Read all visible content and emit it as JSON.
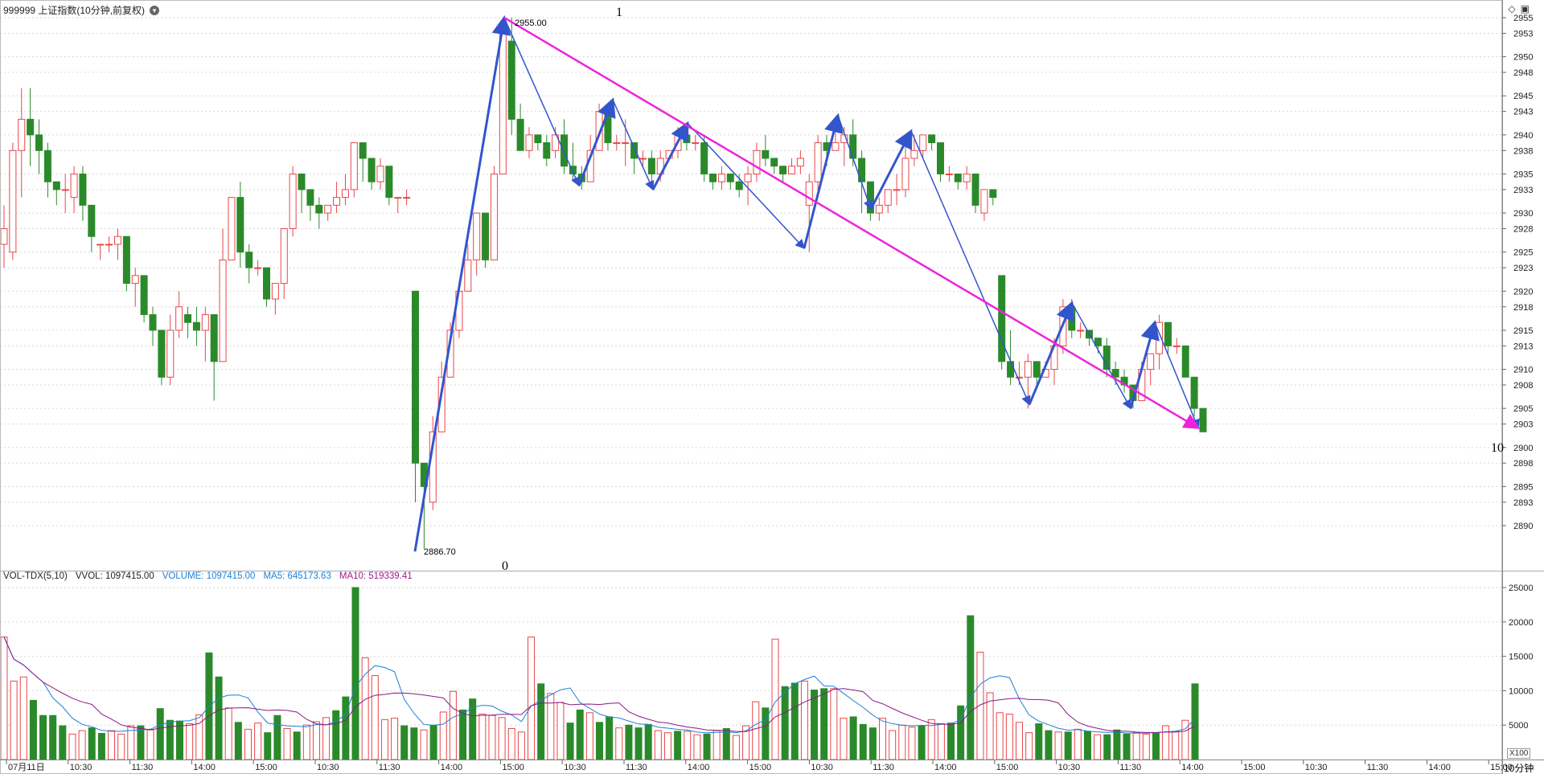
{
  "header": {
    "symbol_title": "999999 上证指数(10分钟,前复权)",
    "dropdown_icon": "chevron-down-icon",
    "icons": [
      "diamond-icon",
      "window-icon"
    ]
  },
  "volume_header": {
    "indicator": "VOL-TDX(5,10)",
    "vvol": "VVOL: 1097415.00",
    "volume": "VOLUME: 1097415.00",
    "ma5": "MA5: 645173.63",
    "ma10": "MA10: 519339.41"
  },
  "footer": {
    "period": "10分钟",
    "vol_scale": "X100"
  },
  "colors": {
    "up": "#e8474a",
    "down": "#2a8a2a",
    "wave": "#3355cc",
    "trend": "#ee22dd",
    "ma5": "#1e7fd6",
    "ma10": "#8b1a85",
    "grid": "#d9d9d9"
  },
  "annotations": {
    "high_label": "2955.00",
    "low_label": "2886.70",
    "wave_start": "0",
    "wave_top": "1",
    "wave_end": "10"
  },
  "chart_data": [
    {
      "type": "candlestick",
      "y_ticks": [
        "2955",
        "2953",
        "2950",
        "2948",
        "2945",
        "2943",
        "2940",
        "2938",
        "2935",
        "2933",
        "2930",
        "2928",
        "2925",
        "2923",
        "2920",
        "2918",
        "2915",
        "2913",
        "2910",
        "2908",
        "2905",
        "2903",
        "2900",
        "2898",
        "2895",
        "2893",
        "2890"
      ],
      "ylim": [
        2887,
        2955
      ],
      "x_ticks": [
        "07月11日",
        "10:30",
        "11:30",
        "14:00",
        "15:00",
        "10:30",
        "11:30",
        "14:00",
        "15:00",
        "10:30",
        "11:30",
        "14:00",
        "15:00",
        "10:30",
        "11:30",
        "14:00",
        "15:00",
        "10:30",
        "11:30",
        "14:00",
        "15:00",
        "10:30",
        "11:30",
        "14:00",
        "15:00"
      ],
      "candles": [
        [
          2926,
          2928,
          2931,
          2923
        ],
        [
          2925,
          2938,
          2939,
          2924
        ],
        [
          2938,
          2942,
          2946,
          2932
        ],
        [
          2942,
          2940,
          2946,
          2936
        ],
        [
          2940,
          2938,
          2942,
          2935
        ],
        [
          2938,
          2934,
          2939,
          2932
        ],
        [
          2934,
          2933,
          2934,
          2931
        ],
        [
          2933,
          2933,
          2935,
          2930
        ],
        [
          2932,
          2935,
          2936,
          2930
        ],
        [
          2935,
          2931,
          2936,
          2929
        ],
        [
          2931,
          2927,
          2931,
          2925
        ],
        [
          2926,
          2926,
          2926,
          2924
        ],
        [
          2926,
          2926,
          2927,
          2925
        ],
        [
          2926,
          2927,
          2928,
          2924
        ],
        [
          2927,
          2921,
          2927,
          2920
        ],
        [
          2921,
          2922,
          2923,
          2918
        ],
        [
          2922,
          2917,
          2922,
          2916
        ],
        [
          2917,
          2915,
          2918,
          2913
        ],
        [
          2915,
          2909,
          2915,
          2908
        ],
        [
          2909,
          2915,
          2917,
          2908
        ],
        [
          2915,
          2918,
          2920,
          2914
        ],
        [
          2917,
          2916,
          2918,
          2914
        ],
        [
          2916,
          2915,
          2918,
          2913
        ],
        [
          2915,
          2917,
          2918,
          2911
        ],
        [
          2917,
          2911,
          2917,
          2906
        ],
        [
          2911,
          2924,
          2928,
          2911
        ],
        [
          2924,
          2932,
          2932,
          2924
        ],
        [
          2932,
          2925,
          2934,
          2923
        ],
        [
          2925,
          2923,
          2926,
          2921
        ],
        [
          2923,
          2923,
          2924,
          2922
        ],
        [
          2923,
          2919,
          2923,
          2918
        ],
        [
          2919,
          2921,
          2921,
          2917
        ],
        [
          2921,
          2928,
          2928,
          2919
        ],
        [
          2928,
          2935,
          2936,
          2927
        ],
        [
          2935,
          2933,
          2935,
          2930
        ],
        [
          2933,
          2931,
          2933,
          2929
        ],
        [
          2931,
          2930,
          2932,
          2928
        ],
        [
          2930,
          2931,
          2931,
          2929
        ],
        [
          2931,
          2932,
          2934,
          2930
        ],
        [
          2932,
          2933,
          2935,
          2931
        ],
        [
          2933,
          2939,
          2939,
          2932
        ],
        [
          2939,
          2937,
          2939,
          2934
        ],
        [
          2937,
          2934,
          2936,
          2933
        ],
        [
          2934,
          2936,
          2937,
          2933
        ],
        [
          2936,
          2932,
          2936,
          2931
        ],
        [
          2932,
          2932,
          2932,
          2930
        ],
        [
          2932,
          2932,
          2933,
          2931
        ],
        [
          2920,
          2898,
          2920,
          2893
        ],
        [
          2898,
          2895,
          2898,
          2887
        ],
        [
          2893,
          2902,
          2904,
          2892
        ],
        [
          2902,
          2909,
          2911,
          2902
        ],
        [
          2909,
          2915,
          2916,
          2909
        ],
        [
          2915,
          2920,
          2921,
          2914
        ],
        [
          2920,
          2924,
          2926,
          2920
        ],
        [
          2924,
          2930,
          2930,
          2922
        ],
        [
          2930,
          2924,
          2930,
          2923
        ],
        [
          2924,
          2935,
          2936,
          2924
        ],
        [
          2935,
          2953,
          2953,
          2935
        ],
        [
          2952,
          2942,
          2955,
          2940
        ],
        [
          2942,
          2938,
          2944,
          2938
        ],
        [
          2938,
          2940,
          2941,
          2937
        ],
        [
          2940,
          2939,
          2940,
          2938
        ],
        [
          2939,
          2937,
          2940,
          2936
        ],
        [
          2938,
          2940,
          2941,
          2937
        ],
        [
          2940,
          2936,
          2942,
          2935
        ],
        [
          2936,
          2935,
          2939,
          2934
        ],
        [
          2935,
          2934,
          2936,
          2933
        ],
        [
          2934,
          2938,
          2940,
          2934
        ],
        [
          2938,
          2943,
          2944,
          2938
        ],
        [
          2943,
          2939,
          2944,
          2938
        ],
        [
          2939,
          2939,
          2940,
          2938
        ],
        [
          2939,
          2939,
          2942,
          2936
        ],
        [
          2939,
          2937,
          2939,
          2935
        ],
        [
          2937,
          2937,
          2938,
          2936
        ],
        [
          2937,
          2935,
          2938,
          2934
        ],
        [
          2935,
          2937,
          2938,
          2934
        ],
        [
          2937,
          2938,
          2938,
          2937
        ],
        [
          2938,
          2940,
          2941,
          2937
        ],
        [
          2940,
          2939,
          2940,
          2938
        ],
        [
          2939,
          2939,
          2940,
          2938
        ],
        [
          2939,
          2935,
          2940,
          2934
        ],
        [
          2935,
          2934,
          2935,
          2933
        ],
        [
          2934,
          2935,
          2936,
          2933
        ],
        [
          2935,
          2934,
          2935,
          2933
        ],
        [
          2934,
          2933,
          2935,
          2932
        ],
        [
          2934,
          2935,
          2936,
          2931
        ],
        [
          2935,
          2938,
          2939,
          2934
        ],
        [
          2938,
          2937,
          2940,
          2936
        ],
        [
          2937,
          2936,
          2937,
          2935
        ],
        [
          2936,
          2935,
          2936,
          2934
        ],
        [
          2935,
          2936,
          2937,
          2935
        ],
        [
          2936,
          2937,
          2938,
          2935
        ],
        [
          2931,
          2934,
          2935,
          2925
        ],
        [
          2934,
          2939,
          2940,
          2933
        ],
        [
          2939,
          2938,
          2940,
          2936
        ],
        [
          2938,
          2939,
          2942,
          2938
        ],
        [
          2939,
          2940,
          2941,
          2936
        ],
        [
          2940,
          2937,
          2942,
          2936
        ],
        [
          2937,
          2934,
          2938,
          2930
        ],
        [
          2934,
          2930,
          2934,
          2929
        ],
        [
          2930,
          2931,
          2932,
          2929
        ],
        [
          2931,
          2933,
          2933,
          2930
        ],
        [
          2933,
          2933,
          2935,
          2931
        ],
        [
          2933,
          2937,
          2939,
          2932
        ],
        [
          2937,
          2938,
          2940,
          2936
        ],
        [
          2938,
          2940,
          2940,
          2937
        ],
        [
          2940,
          2939,
          2940,
          2938
        ],
        [
          2939,
          2935,
          2939,
          2934
        ],
        [
          2935,
          2935,
          2936,
          2934
        ],
        [
          2935,
          2934,
          2935,
          2933
        ],
        [
          2934,
          2935,
          2936,
          2933
        ],
        [
          2935,
          2931,
          2935,
          2930
        ],
        [
          2930,
          2933,
          2933,
          2929
        ],
        [
          2933,
          2932,
          2933,
          2931
        ],
        [
          2922,
          2911,
          2922,
          2910
        ],
        [
          2911,
          2909,
          2915,
          2908
        ],
        [
          2909,
          2909,
          2911,
          2908
        ],
        [
          2909,
          2911,
          2912,
          2905
        ],
        [
          2911,
          2909,
          2911,
          2908
        ],
        [
          2909,
          2910,
          2911,
          2909
        ],
        [
          2910,
          2913,
          2914,
          2908
        ],
        [
          2913,
          2918,
          2919,
          2912
        ],
        [
          2918,
          2915,
          2919,
          2914
        ],
        [
          2915,
          2915,
          2916,
          2914
        ],
        [
          2915,
          2914,
          2915,
          2913
        ],
        [
          2914,
          2913,
          2914,
          2912
        ],
        [
          2913,
          2910,
          2914,
          2909
        ],
        [
          2910,
          2909,
          2911,
          2908
        ],
        [
          2909,
          2908,
          2910,
          2907
        ],
        [
          2908,
          2906,
          2908,
          2905
        ],
        [
          2906,
          2910,
          2911,
          2906
        ],
        [
          2910,
          2912,
          2912,
          2908
        ],
        [
          2912,
          2916,
          2917,
          2910
        ],
        [
          2916,
          2913,
          2916,
          2912
        ],
        [
          2913,
          2913,
          2914,
          2912
        ],
        [
          2913,
          2909,
          2913,
          2909
        ],
        [
          2909,
          2905,
          2909,
          2904
        ],
        [
          2905,
          2902,
          2905,
          2902
        ]
      ],
      "wave_points": [
        [
          516,
          2886.7
        ],
        [
          627,
          2955.0
        ],
        [
          720,
          2933.5
        ],
        [
          762,
          2944.5
        ],
        [
          812,
          2933.0
        ],
        [
          855,
          2941.5
        ],
        [
          1000,
          2925.5
        ],
        [
          1042,
          2942.5
        ],
        [
          1083,
          2930.5
        ],
        [
          1133,
          2940.5
        ],
        [
          1280,
          2905.5
        ],
        [
          1333,
          2918.5
        ],
        [
          1406,
          2905.0
        ],
        [
          1436,
          2916.0
        ],
        [
          1490,
          2902.5
        ]
      ],
      "trend_line": [
        [
          627,
          2955.0
        ],
        [
          1490,
          2902.5
        ]
      ]
    },
    {
      "type": "bar",
      "title": "VOL-TDX(5,10)",
      "y_ticks": [
        "25000",
        "20000",
        "15000",
        "10000",
        "5000"
      ],
      "ylim": [
        0,
        25000
      ],
      "volumes": [
        17800,
        11400,
        12000,
        8600,
        6400,
        6400,
        4900,
        3700,
        4200,
        4600,
        3800,
        4200,
        3700,
        4900,
        4900,
        4300,
        7400,
        5700,
        5600,
        5200,
        6500,
        15500,
        12000,
        7500,
        5400,
        4400,
        5300,
        3900,
        6400,
        4500,
        4000,
        5000,
        5500,
        6100,
        7100,
        9100,
        25000,
        14800,
        12200,
        5800,
        6000,
        4900,
        4600,
        4300,
        5000,
        6900,
        9900,
        7200,
        8800,
        6600,
        6400,
        6100,
        4500,
        4000,
        17800,
        11000,
        9600,
        8300,
        5300,
        7200,
        6800,
        5400,
        6200,
        4600,
        5000,
        4600,
        5100,
        4200,
        3900,
        4100,
        4100,
        3600,
        3700,
        4200,
        4500,
        3500,
        4900,
        8400,
        7500,
        17500,
        10600,
        11100,
        11400,
        10100,
        10300,
        10300,
        6000,
        6200,
        5100,
        4600,
        6000,
        4200,
        5000,
        4700,
        4900,
        5800,
        5200,
        5300,
        7800,
        20900,
        15600,
        9700,
        6800,
        6600,
        5400,
        3900,
        5200,
        4200,
        4000,
        4000,
        4400,
        4100,
        3600,
        3600,
        4300,
        3700,
        3900,
        3700,
        3900,
        4900,
        4100,
        5700,
        11000
      ],
      "ma5_label": "MA5",
      "ma10_label": "MA10"
    }
  ]
}
